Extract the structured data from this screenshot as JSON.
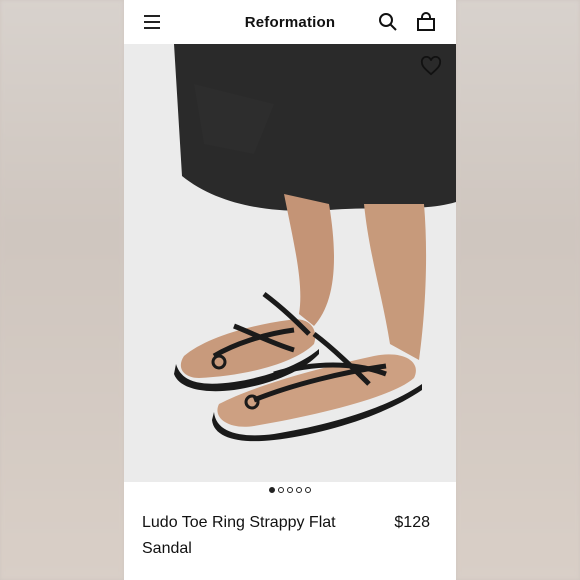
{
  "header": {
    "brand": "Reformation",
    "menu_icon": "hamburger-menu-icon",
    "search_icon": "search-icon",
    "bag_icon": "shopping-bag-icon"
  },
  "hero": {
    "favorite_icon": "heart-icon",
    "carousel": {
      "total": 5,
      "active_index": 0
    }
  },
  "product": {
    "name": "Ludo Toe Ring Strappy Flat Sandal",
    "price": "$128"
  },
  "colors": {
    "background": "#ffffff",
    "text": "#111111",
    "skirt": "#2a2a2a",
    "skin": "#c89a7c",
    "sandal": "#1a1a1a"
  }
}
